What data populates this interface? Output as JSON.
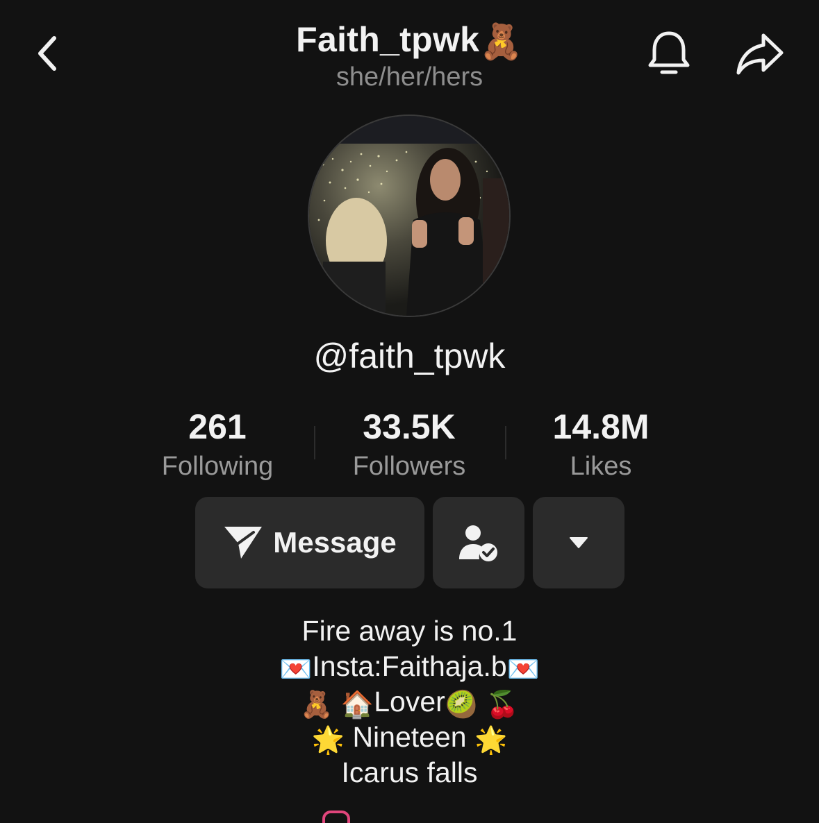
{
  "header": {
    "title": "Faith_tpwk",
    "title_emoji": "🧸",
    "pronouns": "she/her/hers"
  },
  "profile": {
    "handle": "@faith_tpwk"
  },
  "stats": [
    {
      "value": "261",
      "label": "Following"
    },
    {
      "value": "33.5K",
      "label": "Followers"
    },
    {
      "value": "14.8M",
      "label": "Likes"
    }
  ],
  "actions": {
    "message_label": "Message"
  },
  "bio": {
    "line1": "Fire away is no.1",
    "line2_emoji_left": "💌",
    "line2_text": "Insta:Faithaja.b",
    "line2_emoji_right": "💌",
    "line3_emoji_a": "🧸",
    "line3_emoji_b": "🏠",
    "line3_text": "Lover",
    "line3_emoji_c": "🥝",
    "line3_emoji_d": "🍒",
    "line4_emoji_left": "🌟",
    "line4_text": "Nineteen",
    "line4_emoji_right": "🌟",
    "line5": "Icarus falls"
  },
  "icons": {
    "back": "chevron-left-icon",
    "bell": "bell-icon",
    "share": "share-arrow-icon",
    "message": "paper-plane-icon",
    "following": "user-check-icon",
    "more": "caret-down-icon"
  },
  "colors": {
    "background": "#121212",
    "button": "#2b2b2b",
    "secondary_text": "#9a9a9a"
  }
}
